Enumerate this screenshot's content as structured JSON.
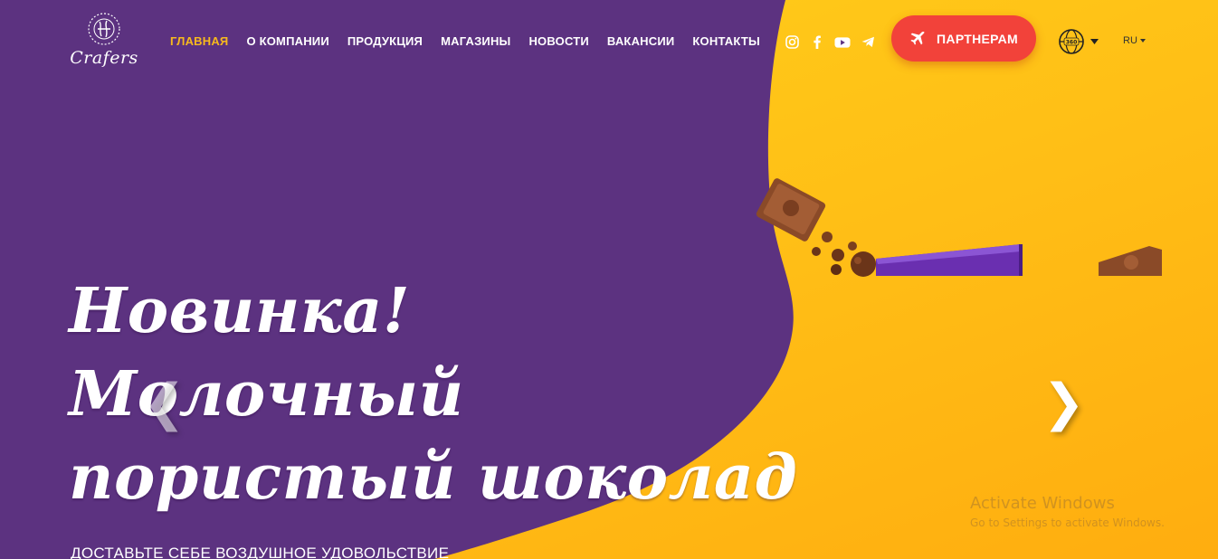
{
  "brand": {
    "logo_text": "Crafers"
  },
  "nav": {
    "items": [
      {
        "label": "ГЛАВНАЯ",
        "active": true
      },
      {
        "label": "О КОМПАНИИ",
        "active": false
      },
      {
        "label": "ПРОДУКЦИЯ",
        "active": false
      },
      {
        "label": "МАГАЗИНЫ",
        "active": false
      },
      {
        "label": "НОВОСТИ",
        "active": false
      },
      {
        "label": "ВАКАНСИИ",
        "active": false
      },
      {
        "label": "КОНТАКТЫ",
        "active": false
      }
    ]
  },
  "social": [
    "instagram-icon",
    "facebook-icon",
    "youtube-icon",
    "telegram-icon"
  ],
  "partner_button": {
    "label": "ПАРТНЕРАМ",
    "icon": "airplane-icon"
  },
  "globe": {
    "icon": "globe-360-icon",
    "badge": "360"
  },
  "language": {
    "selected": "RU"
  },
  "hero": {
    "title_lines": [
      "Новинка!",
      "Молочный",
      "пористый шоколад"
    ],
    "subtitle": "ДОСТАВЬТЕ СЕБЕ ВОЗДУШНОЕ УДОВОЛЬСТВИЕ",
    "prev_arrow": "❮",
    "next_arrow": "❯"
  },
  "watermark": {
    "title": "Activate Windows",
    "subtitle": "Go to Settings to activate Windows."
  },
  "colors": {
    "purple": "#5c3280",
    "yellow": "#ffbe16",
    "accent_red": "#f2423a",
    "active_nav": "#f7b91d"
  }
}
